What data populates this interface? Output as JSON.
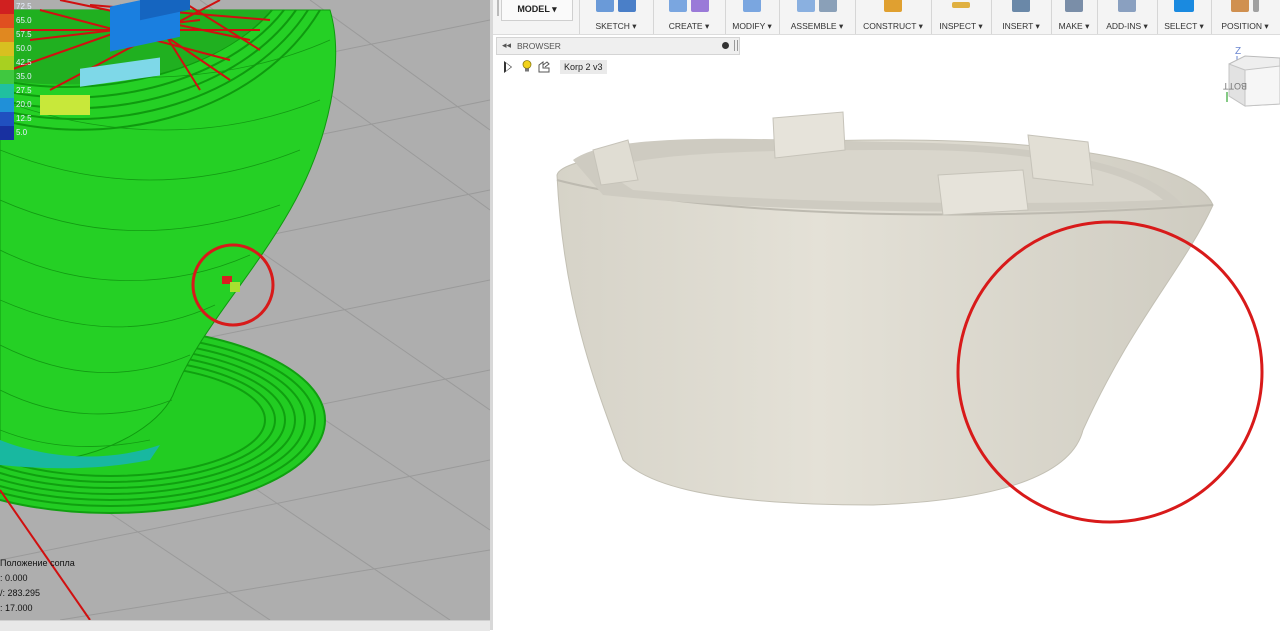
{
  "slicer": {
    "legend_values": [
      "72.5",
      "65.0",
      "57.5",
      "50.0",
      "42.5",
      "35.0",
      "27.5",
      "20.0",
      "12.5",
      "5.0"
    ],
    "legend_colors": [
      "#d02020",
      "#e05020",
      "#e08820",
      "#d8c020",
      "#a8d020",
      "#40c840",
      "#20c0a0",
      "#2090d8",
      "#2050c0",
      "#1830a0"
    ],
    "nozzle_title": "Положение сопла",
    "nozzle_x": ": 0.000",
    "nozzle_y": "/: 283.295",
    "nozzle_z": ": 17.000"
  },
  "fusion": {
    "model_label": "MODEL ▾",
    "toolbar": [
      {
        "label": "SKETCH ▾"
      },
      {
        "label": "CREATE ▾"
      },
      {
        "label": "MODIFY ▾"
      },
      {
        "label": "ASSEMBLE ▾"
      },
      {
        "label": "CONSTRUCT ▾"
      },
      {
        "label": "INSPECT ▾"
      },
      {
        "label": "INSERT ▾"
      },
      {
        "label": "MAKE ▾"
      },
      {
        "label": "ADD-INS ▾"
      },
      {
        "label": "SELECT ▾"
      },
      {
        "label": "POSITION ▾"
      }
    ],
    "browser_title": "BROWSER",
    "component_name": "Korp 2 v3",
    "viewcube_face": "BOTTOM",
    "viewcube_axis": "Z"
  },
  "icons": [
    "collapse-arrows-icon",
    "visibility-bulb-icon",
    "component-icon",
    "expand-triangle-icon",
    "viewcube-icon"
  ]
}
